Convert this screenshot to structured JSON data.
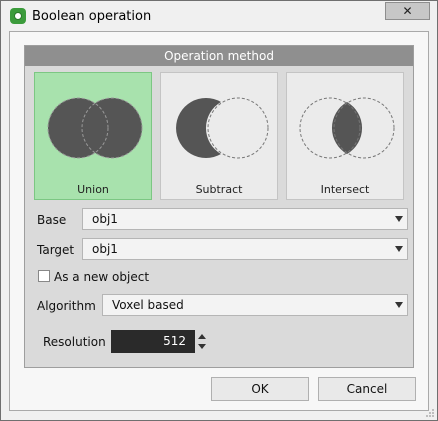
{
  "window": {
    "title": "Boolean operation",
    "close_label": "✕"
  },
  "panel": {
    "title": "Operation method"
  },
  "operations": [
    {
      "label": "Union",
      "selected": true
    },
    {
      "label": "Subtract",
      "selected": false
    },
    {
      "label": "Intersect",
      "selected": false
    }
  ],
  "base": {
    "label": "Base",
    "value": "obj1"
  },
  "target": {
    "label": "Target",
    "value": "obj1"
  },
  "new_object": {
    "label": "As a new object",
    "checked": false
  },
  "algorithm": {
    "label": "Algorithm",
    "value": "Voxel based"
  },
  "resolution": {
    "label": "Resolution",
    "value": "512"
  },
  "buttons": {
    "ok": "OK",
    "cancel": "Cancel"
  },
  "colors": {
    "selected_card": "#a8e2ad",
    "panel_header": "#8f8f8f",
    "shape_fill": "#555555"
  }
}
